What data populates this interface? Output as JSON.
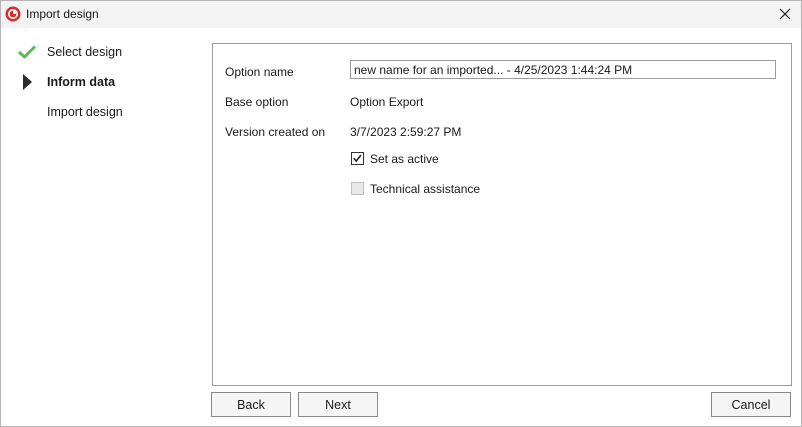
{
  "window": {
    "title": "Import design"
  },
  "steps": [
    {
      "label": "Select design",
      "state": "done",
      "icon": "check-icon",
      "color": "#5cb85c"
    },
    {
      "label": "Inform data",
      "state": "current",
      "icon": "arrow-right-icon",
      "color": "#2b2b2b"
    },
    {
      "label": "Import design",
      "state": "pending"
    }
  ],
  "form": {
    "option_name_label": "Option name",
    "option_name_value": "new name for an imported... - 4/25/2023 1:44:24 PM",
    "base_option_label": "Base option",
    "base_option_value": "Option Export",
    "version_created_label": "Version created on",
    "version_created_value": "3/7/2023 2:59:27 PM",
    "set_active_label": "Set as active",
    "set_active_checked": true,
    "technical_assistance_label": "Technical assistance",
    "technical_assistance_checked": false,
    "technical_assistance_enabled": false
  },
  "buttons": {
    "back": "Back",
    "next": "Next",
    "cancel": "Cancel"
  },
  "colors": {
    "app_icon": "#d32f2f",
    "accent_check": "#5cb85c"
  }
}
